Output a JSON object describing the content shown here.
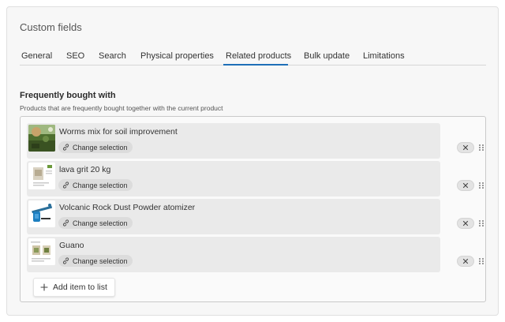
{
  "panel": {
    "title": "Custom fields"
  },
  "tabs": [
    {
      "label": "General"
    },
    {
      "label": "SEO"
    },
    {
      "label": "Search"
    },
    {
      "label": "Physical properties"
    },
    {
      "label": "Related products",
      "active": true
    },
    {
      "label": "Bulk update"
    },
    {
      "label": "Limitations"
    }
  ],
  "section": {
    "title": "Frequently bought with",
    "description": "Products that are frequently bought together with the current product"
  },
  "items": [
    {
      "name": "Worms mix for soil improvement",
      "change_label": "Change selection",
      "thumb": "soil-photo"
    },
    {
      "name": "lava grit 20 kg",
      "change_label": "Change selection",
      "thumb": "product-sheet"
    },
    {
      "name": "Volcanic Rock Dust Powder atomizer",
      "change_label": "Change selection",
      "thumb": "atomizer-photo"
    },
    {
      "name": "Guano",
      "change_label": "Change selection",
      "thumb": "product-sheet"
    }
  ],
  "add_button": {
    "label": "Add item to list",
    "icon": "plus-icon"
  },
  "colors": {
    "accent": "#1e6fb8",
    "panel_bg": "#f7f7f7",
    "item_bg": "#eaeaea"
  }
}
